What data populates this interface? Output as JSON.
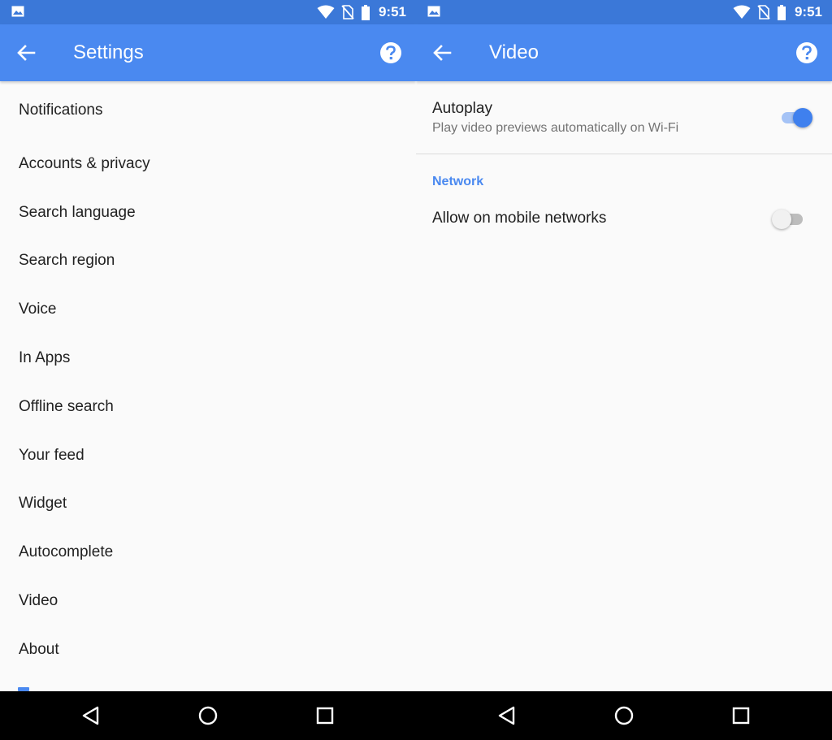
{
  "status_bar": {
    "time_left": "9:51",
    "time_right": "9:51",
    "icons": [
      "gallery-icon",
      "wifi-icon",
      "no-sim-icon",
      "battery-icon"
    ]
  },
  "left_screen": {
    "title": "Settings",
    "items": [
      {
        "label": "Notifications"
      },
      {
        "label": "Accounts & privacy"
      },
      {
        "label": "Search language"
      },
      {
        "label": "Search region"
      },
      {
        "label": "Voice"
      },
      {
        "label": "In Apps"
      },
      {
        "label": "Offline search"
      },
      {
        "label": "Your feed"
      },
      {
        "label": "Widget"
      },
      {
        "label": "Autocomplete"
      },
      {
        "label": "Video"
      },
      {
        "label": "About"
      }
    ]
  },
  "right_screen": {
    "title": "Video",
    "autoplay": {
      "label": "Autoplay",
      "summary": "Play video previews automatically on Wi-Fi",
      "enabled": true
    },
    "network_header": "Network",
    "mobile": {
      "label": "Allow on mobile networks",
      "enabled": false
    }
  },
  "colors": {
    "status_bar": "#3b78d8",
    "app_bar": "#4a89f0",
    "accent": "#3f80ee",
    "background": "#fafafa",
    "nav_bar": "#000000"
  },
  "nav_bar": {
    "buttons": [
      "back-triangle-icon",
      "home-circle-icon",
      "recents-square-icon"
    ]
  }
}
